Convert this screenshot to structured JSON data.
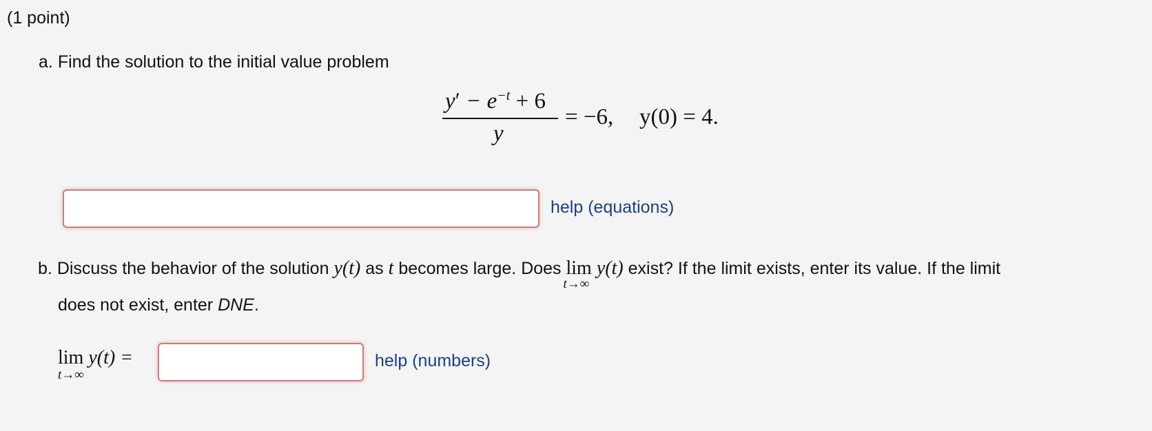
{
  "header": {
    "points": "(1 point)"
  },
  "part_a": {
    "label": "a.",
    "prompt": "Find the solution to the initial value problem",
    "equation": {
      "numerator": {
        "y": "y",
        "prime": "′",
        "minus": " − e",
        "exp": "−t",
        "plus": " + 6"
      },
      "denominator": "y",
      "rhs": "= −6,",
      "initial": "y(0) = 4."
    },
    "answer": {
      "value": "",
      "placeholder": ""
    },
    "help_link": "help (equations)"
  },
  "part_b": {
    "label": "b.",
    "text1": "Discuss the behavior of the solution ",
    "func": "y(t)",
    "text2": " as ",
    "var": "t",
    "text3": " becomes large. Does ",
    "lim_word": "lim",
    "lim_sub": "t→∞",
    "text4": " exist? If the limit exists, enter its value. If the limit",
    "line2_text": "does not exist, enter ",
    "dne": "DNE",
    "line2_end": ".",
    "answer_prefix_lim": "lim",
    "answer_prefix_sub": "t→∞",
    "answer_prefix_func": "y(t) =",
    "answer": {
      "value": "",
      "placeholder": ""
    },
    "help_link": "help (numbers)"
  }
}
